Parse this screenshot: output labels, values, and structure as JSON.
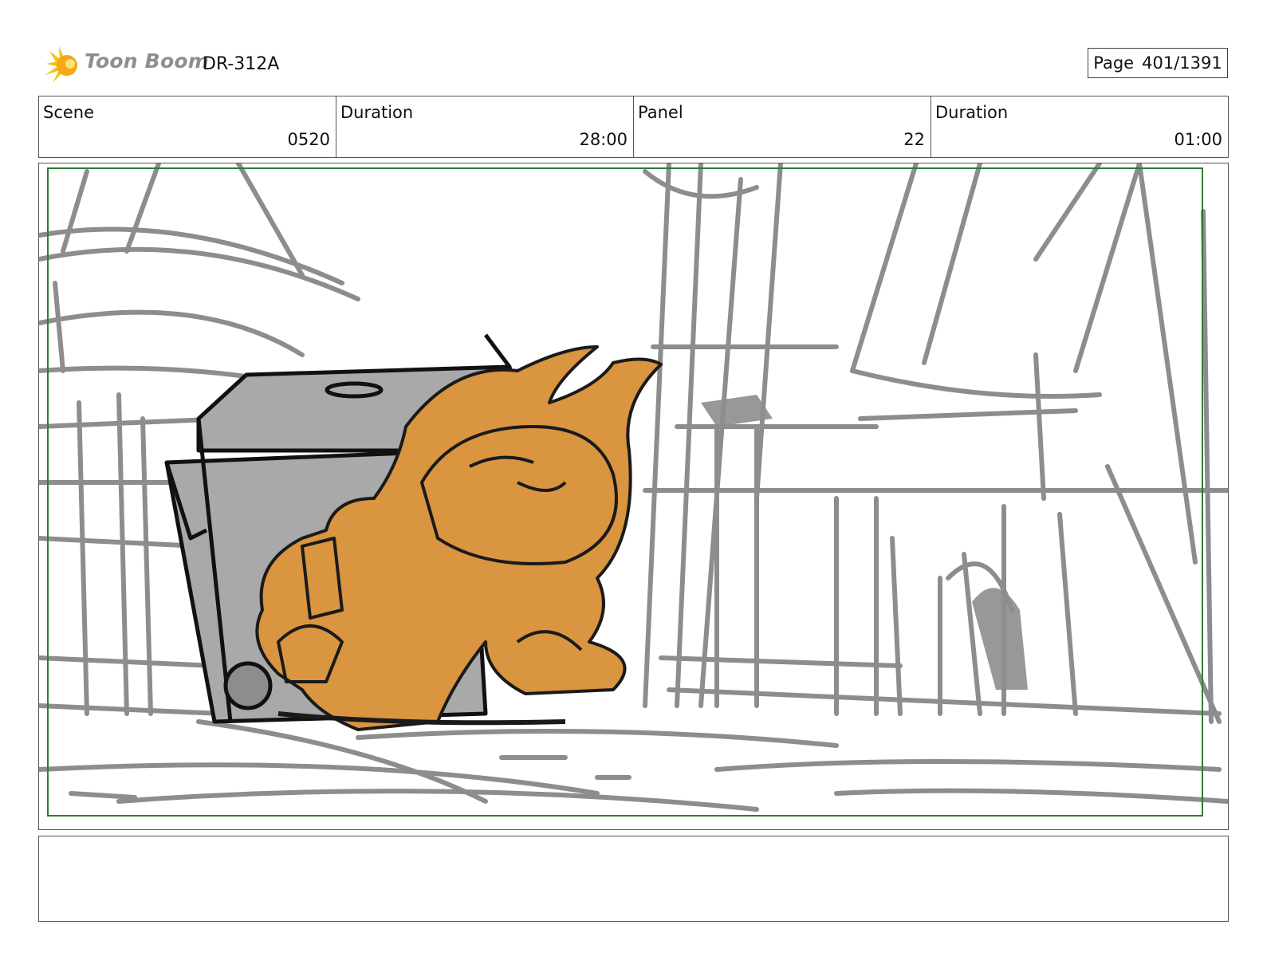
{
  "header": {
    "brand": "Toon Boom",
    "doc_id": "DR-312A",
    "page_label": "Page",
    "page_value": "401/1391"
  },
  "info": {
    "scene_label": "Scene",
    "scene_value": "0520",
    "scene_duration_label": "Duration",
    "scene_duration_value": "28:00",
    "panel_label": "Panel",
    "panel_value": "22",
    "panel_duration_label": "Duration",
    "panel_duration_value": "01:00"
  },
  "colors": {
    "character_fill": "#d9953f",
    "sketch_gray": "#8d8d8d",
    "object_gray": "#a9a9a9",
    "safe_frame": "#2e7d32",
    "logo_yellow": "#f5c018"
  },
  "icons": {
    "logo": "toon-boom-sun-logo-icon"
  },
  "notes": ""
}
